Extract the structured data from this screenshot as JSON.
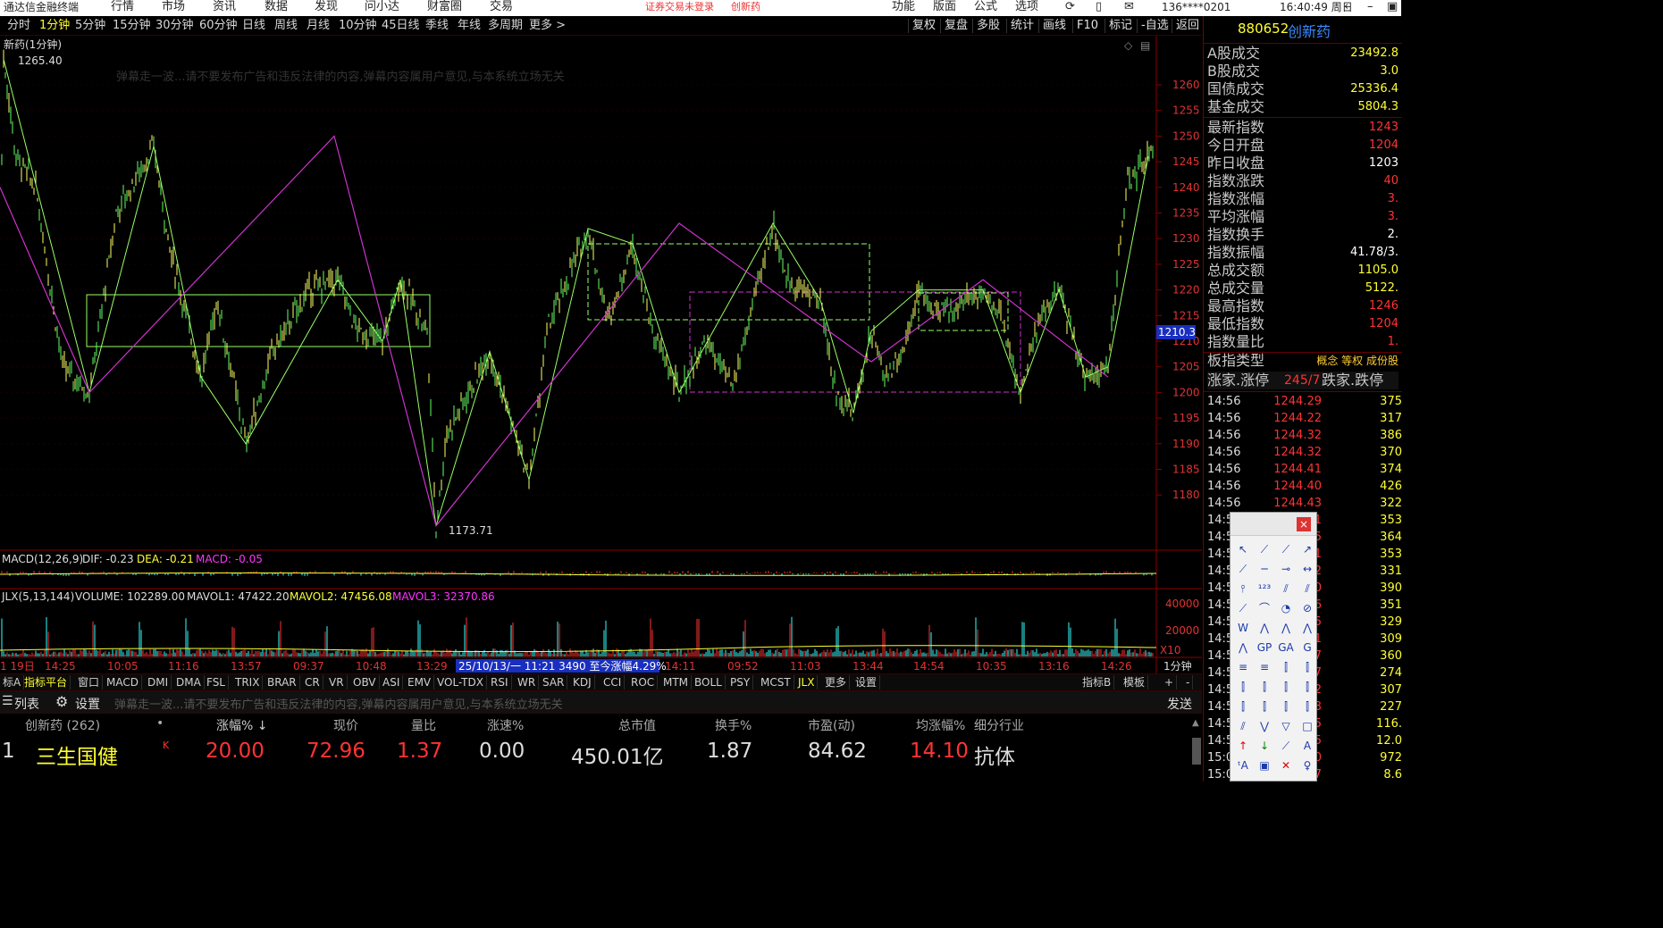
{
  "menubar": {
    "app_title": "通达信金融终端",
    "items": [
      "行情",
      "市场",
      "资讯",
      "数据",
      "发现",
      "问小达",
      "财富圈",
      "交易"
    ],
    "notice": "证券交易未登录",
    "notice_name": "创新药",
    "right_items": [
      "功能",
      "版面",
      "公式",
      "选项"
    ],
    "account": "136****0201",
    "time": "16:40:49 周日"
  },
  "periods": [
    "分时",
    "1分钟",
    "5分钟",
    "15分钟",
    "30分钟",
    "60分钟",
    "日线",
    "周线",
    "月线",
    "10分钟",
    "45日线",
    "季线",
    "年线",
    "多周期",
    "更多 >"
  ],
  "toolbar": [
    "复权",
    "复盘",
    "多股",
    "统计",
    "画线",
    "F10",
    "标记",
    "-自选",
    "返回"
  ],
  "chart": {
    "title": "新药(1分钟)",
    "high_label": "1265.40",
    "low_label": "1173.71",
    "price_ticks": [
      "1260",
      "1255",
      "1250",
      "1245",
      "1240",
      "1235",
      "1230",
      "1225",
      "1220",
      "1215",
      "1210",
      "1205",
      "1200",
      "1195",
      "1190",
      "1185",
      "1180"
    ],
    "current_price_tag": "1210.3",
    "watermark": "弹幕走一波...请不要发布广告和违反法律的内容,弹幕内容属用户意见,与本系统立场无关"
  },
  "macd": {
    "label": "MACD(12,26,9)",
    "dif": "DIF: -0.23",
    "dea": "DEA: -0.21",
    "macd": "MACD: -0.05"
  },
  "volume": {
    "label": "JLX(5,13,144)",
    "volume": "VOLUME: 102289.00",
    "mavol1": "MAVOL1: 47422.20",
    "mavol2": "MAVOL2: 47456.08",
    "mavol3": "MAVOL3: 32370.86",
    "ticks": [
      "40000",
      "20000"
    ],
    "unit": "X10"
  },
  "time_axis": [
    "1 19日",
    "14:25",
    "10:05",
    "11:16",
    "13:57",
    "09:37",
    "10:48",
    "13:29",
    "25/10/13/一 11:21 3490 至今涨幅4.29%",
    "14:11",
    "09:52",
    "11:03",
    "13:44",
    "14:54",
    "10:35",
    "13:16",
    "14:26",
    "1分钟"
  ],
  "indicator_tabs": [
    "标A",
    "指标平台",
    "窗口",
    "MACD",
    "DMI",
    "DMA",
    "FSL",
    "TRIX",
    "BRAR",
    "CR",
    "VR",
    "OBV",
    "ASI",
    "EMV",
    "VOL-TDX",
    "RSI",
    "WR",
    "SAR",
    "KDJ",
    "CCI",
    "ROC",
    "MTM",
    "BOLL",
    "PSY",
    "MCST",
    "JLX",
    "更多",
    "设置"
  ],
  "indicator_right": [
    "指标B",
    "模板",
    "+",
    "-"
  ],
  "msg": {
    "list": "列表",
    "settings": "设置",
    "send": "发送"
  },
  "stock_header": [
    "创新药 (262)",
    "•",
    "涨幅% ↓",
    "现价",
    "量比",
    "涨速%",
    "总市值",
    "换手%",
    "市盈(动)",
    "均涨幅%",
    "细分行业"
  ],
  "stock_row": {
    "idx": "1",
    "name": "三生国健",
    "flag": "K",
    "change": "20.00",
    "price": "72.96",
    "vol_ratio": "1.37",
    "speed": "0.00",
    "mcap": "450.01亿",
    "turnover": "1.87",
    "pe": "84.62",
    "avg_change": "14.10",
    "industry": "抗体"
  },
  "right_panel": {
    "code": "880652",
    "name": "创新药",
    "top_rows": [
      [
        "A股成交",
        "23492.8"
      ],
      [
        "B股成交",
        "3.0"
      ],
      [
        "国债成交",
        "25336.4"
      ],
      [
        "基金成交",
        "5804.3"
      ]
    ],
    "stats": [
      [
        "最新指数",
        "1243"
      ],
      [
        "今日开盘",
        "1204"
      ],
      [
        "昨日收盘",
        "1203"
      ],
      [
        "指数涨跌",
        "40"
      ],
      [
        "指数涨幅",
        "3."
      ],
      [
        "平均涨幅",
        "3."
      ],
      [
        "指数换手",
        "2."
      ],
      [
        "指数振幅",
        "41.78/3."
      ],
      [
        "总成交额",
        "1105.0"
      ],
      [
        "总成交量",
        "5122."
      ],
      [
        "最高指数",
        "1246"
      ],
      [
        "最低指数",
        "1204"
      ],
      [
        "指数量比",
        "1."
      ]
    ],
    "type_label": "板指类型",
    "type_value": "概念 等权 成份股",
    "up_label": "涨家.涨停",
    "up_value": "245/7",
    "down_label": "跌家.跌停",
    "ticks": [
      [
        "14:56",
        "1244.29",
        "375"
      ],
      [
        "14:56",
        "1244.22",
        "317"
      ],
      [
        "14:56",
        "1244.32",
        "386"
      ],
      [
        "14:56",
        "1244.32",
        "370"
      ],
      [
        "14:56",
        "1244.41",
        "374"
      ],
      [
        "14:56",
        "1244.40",
        "426"
      ],
      [
        "14:56",
        "1244.43",
        "322"
      ],
      [
        "14:5",
        "31",
        "353"
      ],
      [
        "14:5",
        "35",
        "364"
      ],
      [
        "14:5",
        "31",
        "353"
      ],
      [
        "14:5",
        "32",
        "331"
      ],
      [
        "14:5",
        "30",
        "390"
      ],
      [
        "14:5",
        "36",
        "351"
      ],
      [
        "14:5",
        "45",
        "329"
      ],
      [
        "14:5",
        "51",
        "309"
      ],
      [
        "14:5",
        "47",
        "360"
      ],
      [
        "14:5",
        "47",
        "274"
      ],
      [
        "14:5",
        "52",
        "307"
      ],
      [
        "14:5",
        "53",
        "227"
      ],
      [
        "14:5",
        "55",
        "116."
      ],
      [
        "14:5",
        "55",
        "12.0"
      ],
      [
        "15:0",
        "60",
        "972"
      ],
      [
        "15:0",
        "97",
        "8.6"
      ]
    ]
  },
  "toolbox": {
    "close": "×"
  },
  "colors": {
    "up": "#ff3333",
    "down": "#33ff99",
    "kline_green": "#66ff66",
    "kline_yellow": "#ffff66",
    "zigzag": "#cc33cc",
    "box_green": "#99ff66",
    "box_magenta": "#cc33cc",
    "accent_blue": "#3a5fff"
  }
}
